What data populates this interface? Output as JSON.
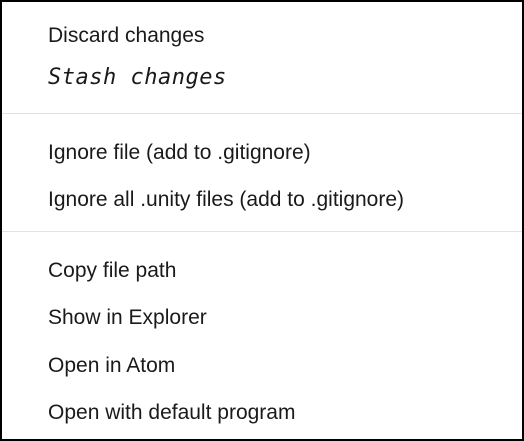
{
  "menu": {
    "items": [
      {
        "label": "Discard changes"
      },
      {
        "label": "Stash changes"
      },
      {
        "label": "Ignore file (add to .gitignore)"
      },
      {
        "label": "Ignore all .unity files (add to .gitignore)"
      },
      {
        "label": "Copy file path"
      },
      {
        "label": "Show in Explorer"
      },
      {
        "label": "Open in Atom"
      },
      {
        "label": "Open with default program"
      }
    ]
  }
}
